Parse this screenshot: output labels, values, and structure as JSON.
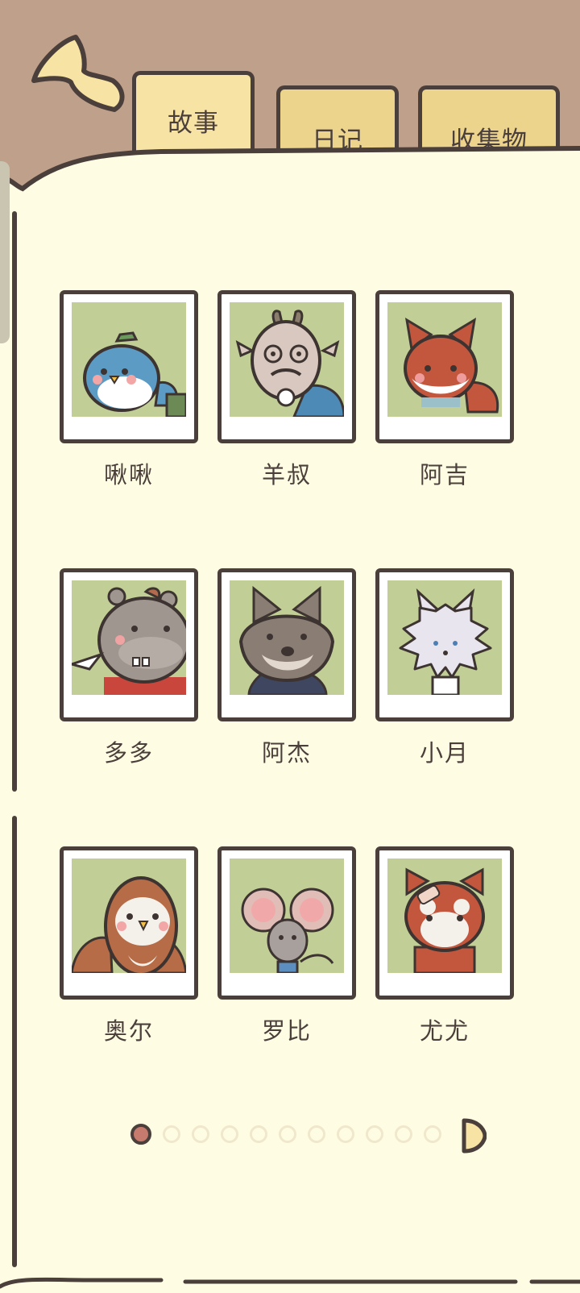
{
  "tabs": [
    {
      "label": "故事",
      "active": true
    },
    {
      "label": "日记",
      "active": false
    },
    {
      "label": "收集物",
      "active": false
    }
  ],
  "characters": [
    {
      "name": "啾啾",
      "portrait": "blue-bird-icon"
    },
    {
      "name": "羊叔",
      "portrait": "goat-icon"
    },
    {
      "name": "阿吉",
      "portrait": "fox-icon"
    },
    {
      "name": "多多",
      "portrait": "hippo-icon"
    },
    {
      "name": "阿杰",
      "portrait": "wolf-icon"
    },
    {
      "name": "小月",
      "portrait": "white-dog-icon"
    },
    {
      "name": "奥尔",
      "portrait": "owl-icon"
    },
    {
      "name": "罗比",
      "portrait": "mouse-icon"
    },
    {
      "name": "尤尤",
      "portrait": "red-panda-icon"
    }
  ],
  "pagination": {
    "current_page": 1,
    "total_pages": 11
  },
  "colors": {
    "page": "#fefde3",
    "background": "#bfa08b",
    "tab": "#f7e3a4",
    "outline": "#4b3f3b",
    "photo_bg": "#c1cf96",
    "active_dot": "#c77b6e"
  }
}
